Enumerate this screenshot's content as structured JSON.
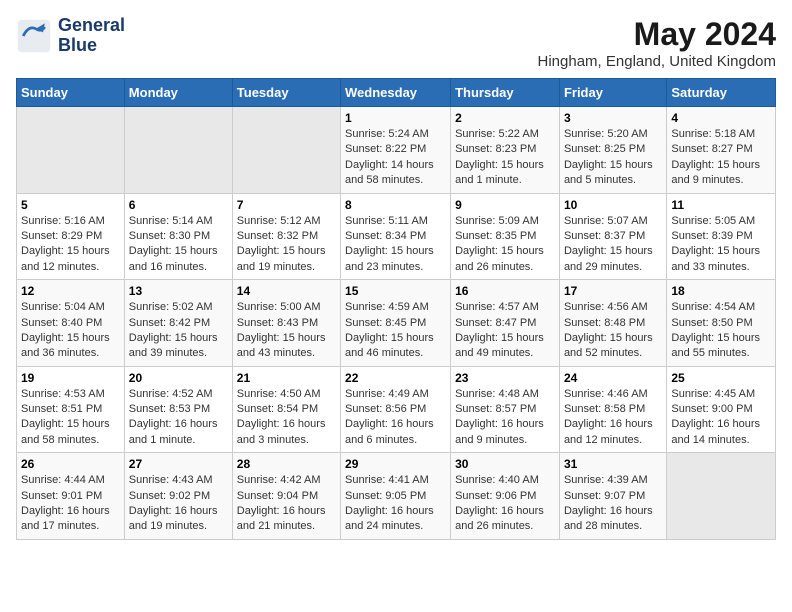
{
  "header": {
    "logo_line1": "General",
    "logo_line2": "Blue",
    "month_year": "May 2024",
    "location": "Hingham, England, United Kingdom"
  },
  "days_of_week": [
    "Sunday",
    "Monday",
    "Tuesday",
    "Wednesday",
    "Thursday",
    "Friday",
    "Saturday"
  ],
  "weeks": [
    [
      {
        "day": "",
        "info": ""
      },
      {
        "day": "",
        "info": ""
      },
      {
        "day": "",
        "info": ""
      },
      {
        "day": "1",
        "info": "Sunrise: 5:24 AM\nSunset: 8:22 PM\nDaylight: 14 hours and 58 minutes."
      },
      {
        "day": "2",
        "info": "Sunrise: 5:22 AM\nSunset: 8:23 PM\nDaylight: 15 hours and 1 minute."
      },
      {
        "day": "3",
        "info": "Sunrise: 5:20 AM\nSunset: 8:25 PM\nDaylight: 15 hours and 5 minutes."
      },
      {
        "day": "4",
        "info": "Sunrise: 5:18 AM\nSunset: 8:27 PM\nDaylight: 15 hours and 9 minutes."
      }
    ],
    [
      {
        "day": "5",
        "info": "Sunrise: 5:16 AM\nSunset: 8:29 PM\nDaylight: 15 hours and 12 minutes."
      },
      {
        "day": "6",
        "info": "Sunrise: 5:14 AM\nSunset: 8:30 PM\nDaylight: 15 hours and 16 minutes."
      },
      {
        "day": "7",
        "info": "Sunrise: 5:12 AM\nSunset: 8:32 PM\nDaylight: 15 hours and 19 minutes."
      },
      {
        "day": "8",
        "info": "Sunrise: 5:11 AM\nSunset: 8:34 PM\nDaylight: 15 hours and 23 minutes."
      },
      {
        "day": "9",
        "info": "Sunrise: 5:09 AM\nSunset: 8:35 PM\nDaylight: 15 hours and 26 minutes."
      },
      {
        "day": "10",
        "info": "Sunrise: 5:07 AM\nSunset: 8:37 PM\nDaylight: 15 hours and 29 minutes."
      },
      {
        "day": "11",
        "info": "Sunrise: 5:05 AM\nSunset: 8:39 PM\nDaylight: 15 hours and 33 minutes."
      }
    ],
    [
      {
        "day": "12",
        "info": "Sunrise: 5:04 AM\nSunset: 8:40 PM\nDaylight: 15 hours and 36 minutes."
      },
      {
        "day": "13",
        "info": "Sunrise: 5:02 AM\nSunset: 8:42 PM\nDaylight: 15 hours and 39 minutes."
      },
      {
        "day": "14",
        "info": "Sunrise: 5:00 AM\nSunset: 8:43 PM\nDaylight: 15 hours and 43 minutes."
      },
      {
        "day": "15",
        "info": "Sunrise: 4:59 AM\nSunset: 8:45 PM\nDaylight: 15 hours and 46 minutes."
      },
      {
        "day": "16",
        "info": "Sunrise: 4:57 AM\nSunset: 8:47 PM\nDaylight: 15 hours and 49 minutes."
      },
      {
        "day": "17",
        "info": "Sunrise: 4:56 AM\nSunset: 8:48 PM\nDaylight: 15 hours and 52 minutes."
      },
      {
        "day": "18",
        "info": "Sunrise: 4:54 AM\nSunset: 8:50 PM\nDaylight: 15 hours and 55 minutes."
      }
    ],
    [
      {
        "day": "19",
        "info": "Sunrise: 4:53 AM\nSunset: 8:51 PM\nDaylight: 15 hours and 58 minutes."
      },
      {
        "day": "20",
        "info": "Sunrise: 4:52 AM\nSunset: 8:53 PM\nDaylight: 16 hours and 1 minute."
      },
      {
        "day": "21",
        "info": "Sunrise: 4:50 AM\nSunset: 8:54 PM\nDaylight: 16 hours and 3 minutes."
      },
      {
        "day": "22",
        "info": "Sunrise: 4:49 AM\nSunset: 8:56 PM\nDaylight: 16 hours and 6 minutes."
      },
      {
        "day": "23",
        "info": "Sunrise: 4:48 AM\nSunset: 8:57 PM\nDaylight: 16 hours and 9 minutes."
      },
      {
        "day": "24",
        "info": "Sunrise: 4:46 AM\nSunset: 8:58 PM\nDaylight: 16 hours and 12 minutes."
      },
      {
        "day": "25",
        "info": "Sunrise: 4:45 AM\nSunset: 9:00 PM\nDaylight: 16 hours and 14 minutes."
      }
    ],
    [
      {
        "day": "26",
        "info": "Sunrise: 4:44 AM\nSunset: 9:01 PM\nDaylight: 16 hours and 17 minutes."
      },
      {
        "day": "27",
        "info": "Sunrise: 4:43 AM\nSunset: 9:02 PM\nDaylight: 16 hours and 19 minutes."
      },
      {
        "day": "28",
        "info": "Sunrise: 4:42 AM\nSunset: 9:04 PM\nDaylight: 16 hours and 21 minutes."
      },
      {
        "day": "29",
        "info": "Sunrise: 4:41 AM\nSunset: 9:05 PM\nDaylight: 16 hours and 24 minutes."
      },
      {
        "day": "30",
        "info": "Sunrise: 4:40 AM\nSunset: 9:06 PM\nDaylight: 16 hours and 26 minutes."
      },
      {
        "day": "31",
        "info": "Sunrise: 4:39 AM\nSunset: 9:07 PM\nDaylight: 16 hours and 28 minutes."
      },
      {
        "day": "",
        "info": ""
      }
    ]
  ]
}
